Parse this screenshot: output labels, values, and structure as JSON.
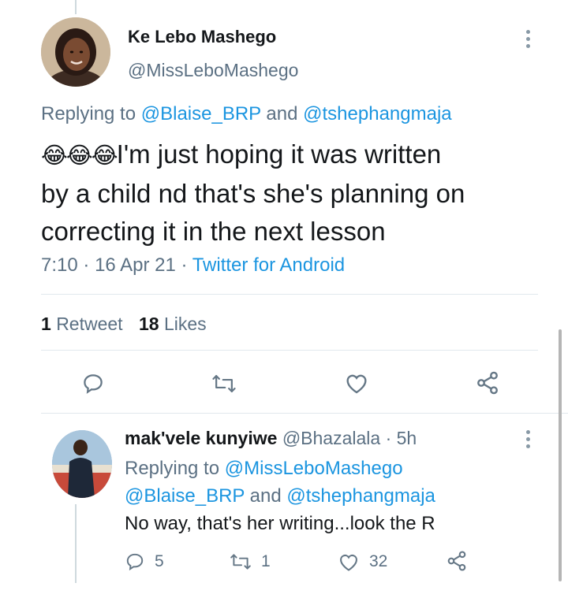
{
  "main_tweet": {
    "display_name": "Ke Lebo Mashego",
    "handle": "@MissLeboMashego",
    "replying_prefix": "Replying to",
    "mention_1": "@Blaise_BRP",
    "and_word": "and",
    "mention_2": "@tshephangmaja",
    "emoji": "😂😂😂",
    "line1": "I'm just hoping it was written",
    "line2": "by a child nd that's she's planning on",
    "line3": "correcting it in the next lesson",
    "time": "7:10",
    "sep1": "·",
    "date": "16 Apr 21",
    "sep2": "·",
    "source": "Twitter for Android",
    "retweets_count": "1",
    "retweets_label": "Retweet",
    "likes_count": "18",
    "likes_label": "Likes"
  },
  "reply_tweet": {
    "display_name": "mak'vele kunyiwe",
    "handle": "@Bhazalala",
    "sep": "·",
    "age": "5h",
    "replying_prefix": "Replying to",
    "mention_1": "@MissLeboMashego",
    "mention_2": "@Blaise_BRP",
    "and_word": "and",
    "mention_3": "@tshephangmaja",
    "text": "No way, that's her writing...look the R",
    "reply_count": "5",
    "retweet_count": "1",
    "like_count": "32"
  },
  "icons": [
    "reply-icon",
    "retweet-icon",
    "like-icon",
    "share-icon",
    "more-icon"
  ],
  "colors": {
    "link": "#1b95e0",
    "muted": "#5b7083",
    "text": "#14171a"
  }
}
